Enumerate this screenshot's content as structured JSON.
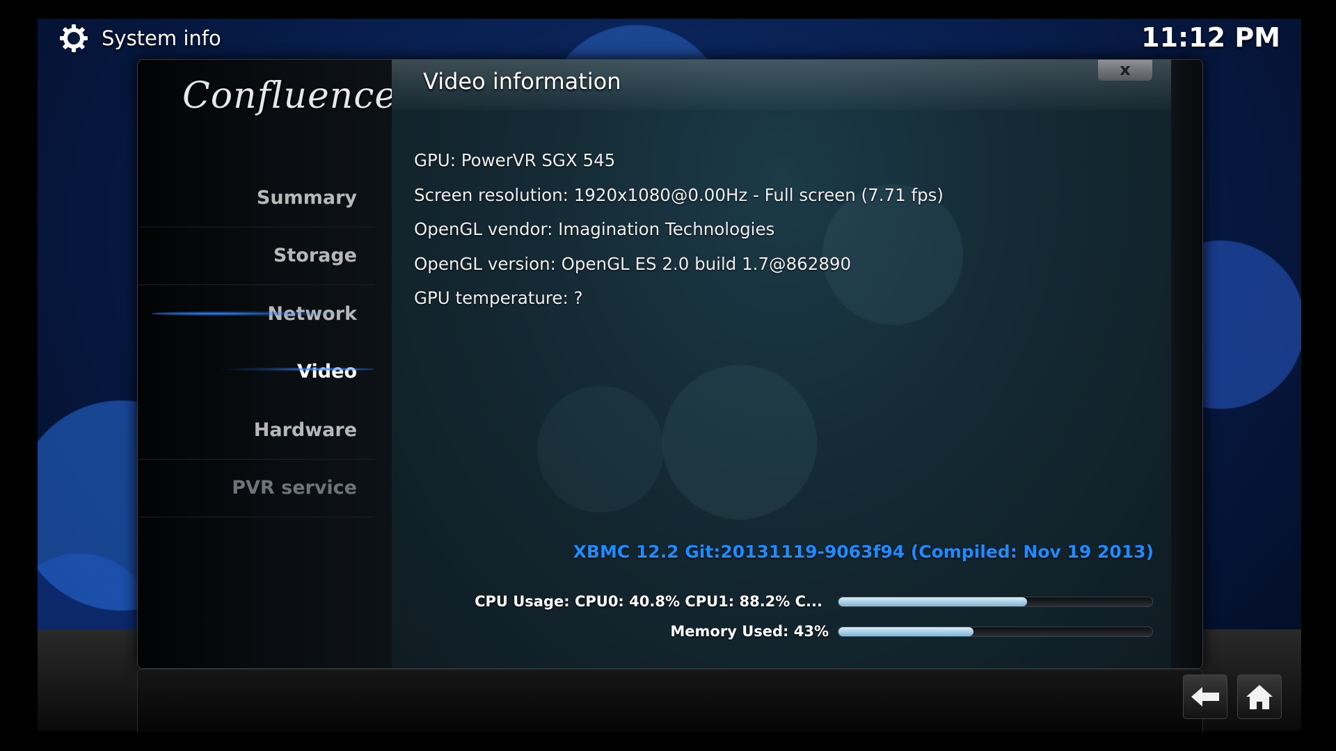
{
  "header": {
    "title": "System info",
    "icon": "gear-icon",
    "clock": "11:12 PM"
  },
  "logo": "Confluence",
  "sidebar": {
    "items": [
      {
        "label": "Summary"
      },
      {
        "label": "Storage"
      },
      {
        "label": "Network"
      },
      {
        "label": "Video",
        "active": true
      },
      {
        "label": "Hardware"
      },
      {
        "label": "PVR service"
      }
    ]
  },
  "main": {
    "title": "Video information",
    "close_label": "x",
    "info": [
      "GPU: PowerVR SGX 545",
      "Screen resolution: 1920x1080@0.00Hz - Full screen (7.71 fps)",
      "OpenGL vendor: Imagination Technologies",
      "OpenGL version: OpenGL ES 2.0 build 1.7@862890",
      "GPU temperature: ?"
    ],
    "version": "XBMC 12.2 Git:20131119-9063f94 (Compiled: Nov 19 2013)",
    "cpu": {
      "label": "CPU Usage: CPU0: 40.8% CPU1: 88.2% C...",
      "percent": 60
    },
    "memory": {
      "label": "Memory Used: 43%",
      "percent": 43
    }
  },
  "footer": {
    "back_icon": "back-arrow-icon",
    "home_icon": "home-icon"
  },
  "colors": {
    "accent": "#1f8bff",
    "nav_glow": "#3a8dff",
    "background": "#071a45"
  }
}
